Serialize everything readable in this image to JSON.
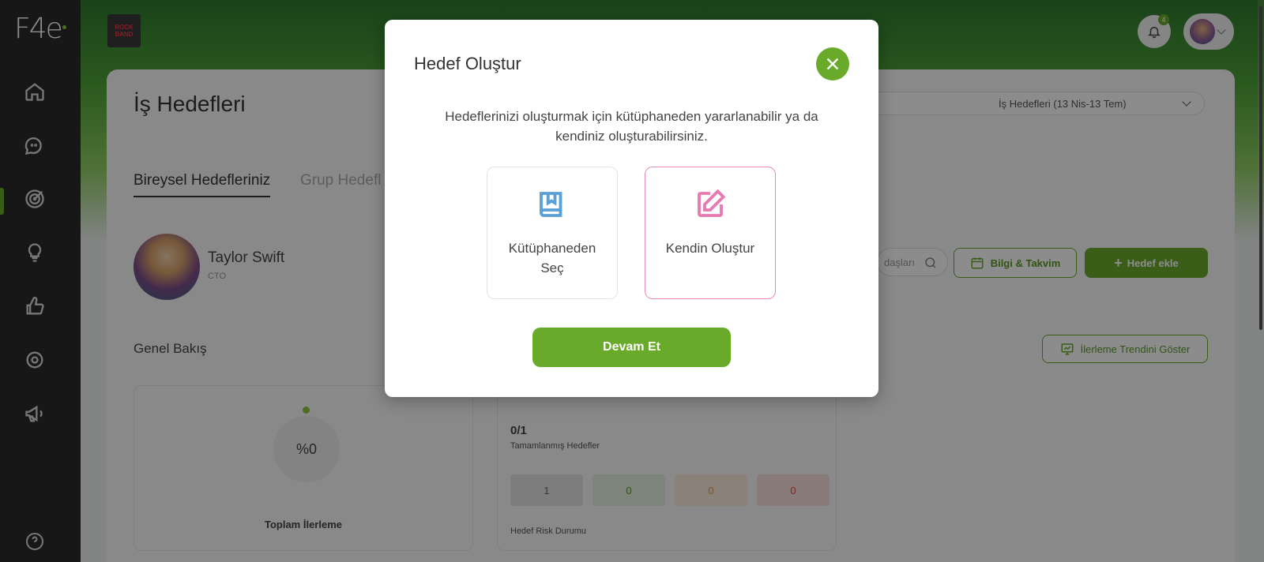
{
  "app": {
    "logo_text": "F4e"
  },
  "brand": {
    "thumb_text": "ROCK BAND"
  },
  "header": {
    "notification_count": "4"
  },
  "page": {
    "title": "İş Hedefleri",
    "period_value": "İş Hedefleri (13 Nis-13 Tem)",
    "tabs": [
      {
        "label": "Bireysel Hedefleriniz",
        "active": true
      },
      {
        "label": "Grup Hedefl",
        "active": false
      }
    ]
  },
  "profile": {
    "name": "Taylor Swift",
    "role": "CTO"
  },
  "toolbar": {
    "search_placeholder": "daşları",
    "info_calendar_label": "Bilgi & Takvim",
    "add_goal_label": "Hedef ekle",
    "trend_label": "İlerleme Trendini Göster"
  },
  "overview": {
    "title": "Genel Bakış",
    "progress_value": "%0",
    "progress_label": "Toplam İlerleme",
    "completed_count": "0/1",
    "completed_label": "Tamamlanmış Hedefler",
    "risk_values": [
      "1",
      "0",
      "0",
      "0"
    ],
    "risk_label": "Hedef Risk Durumu"
  },
  "modal": {
    "title": "Hedef Oluştur",
    "description": "Hedeflerinizi oluşturmak için kütüphaneden yararlanabilir ya da kendiniz oluşturabilirsiniz.",
    "option_library": "Kütüphaneden Seç",
    "option_self": "Kendin Oluştur",
    "continue_label": "Devam Et"
  },
  "colors": {
    "accent": "#6aaa2b",
    "sidebar": "#2b2b2b",
    "option_selected": "#e88ab8",
    "library_icon": "#5aa0d6"
  },
  "icons": {
    "sidebar": [
      "home-icon",
      "chat-icon",
      "target-icon",
      "lightbulb-icon",
      "thumbs-up-icon",
      "settings-icon",
      "megaphone-icon",
      "help-icon"
    ]
  }
}
